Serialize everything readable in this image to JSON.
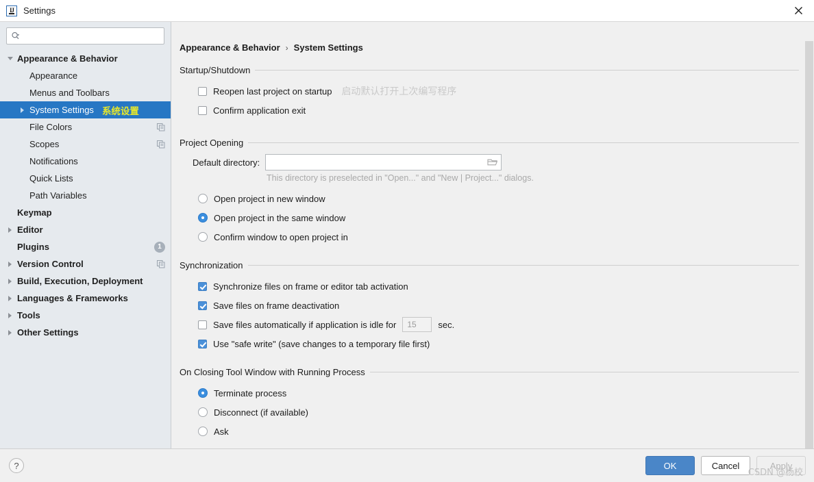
{
  "window": {
    "title": "Settings",
    "app_icon": "intellij-idea-icon",
    "close_icon": "close-icon"
  },
  "sidebar": {
    "search": {
      "value": "",
      "placeholder": "",
      "icon": "search-icon"
    },
    "items": [
      {
        "label": "Appearance & Behavior",
        "indent": 0,
        "bold": true,
        "arrow": "down",
        "selected": false,
        "right": ""
      },
      {
        "label": "Appearance",
        "indent": 1,
        "bold": false,
        "arrow": "none",
        "selected": false,
        "right": ""
      },
      {
        "label": "Menus and Toolbars",
        "indent": 1,
        "bold": false,
        "arrow": "none",
        "selected": false,
        "right": ""
      },
      {
        "label": "System Settings",
        "indent": 1,
        "bold": false,
        "arrow": "right",
        "selected": true,
        "right": "",
        "annotation": "系统设置"
      },
      {
        "label": "File Colors",
        "indent": 1,
        "bold": false,
        "arrow": "none",
        "selected": false,
        "right": "copy-icon"
      },
      {
        "label": "Scopes",
        "indent": 1,
        "bold": false,
        "arrow": "none",
        "selected": false,
        "right": "copy-icon"
      },
      {
        "label": "Notifications",
        "indent": 1,
        "bold": false,
        "arrow": "none",
        "selected": false,
        "right": ""
      },
      {
        "label": "Quick Lists",
        "indent": 1,
        "bold": false,
        "arrow": "none",
        "selected": false,
        "right": ""
      },
      {
        "label": "Path Variables",
        "indent": 1,
        "bold": false,
        "arrow": "none",
        "selected": false,
        "right": ""
      },
      {
        "label": "Keymap",
        "indent": 0,
        "bold": true,
        "arrow": "none",
        "selected": false,
        "right": ""
      },
      {
        "label": "Editor",
        "indent": 0,
        "bold": true,
        "arrow": "right",
        "selected": false,
        "right": ""
      },
      {
        "label": "Plugins",
        "indent": 0,
        "bold": true,
        "arrow": "none",
        "selected": false,
        "right": "badge",
        "badge": "1"
      },
      {
        "label": "Version Control",
        "indent": 0,
        "bold": true,
        "arrow": "right",
        "selected": false,
        "right": "copy-icon"
      },
      {
        "label": "Build, Execution, Deployment",
        "indent": 0,
        "bold": true,
        "arrow": "right",
        "selected": false,
        "right": ""
      },
      {
        "label": "Languages & Frameworks",
        "indent": 0,
        "bold": true,
        "arrow": "right",
        "selected": false,
        "right": ""
      },
      {
        "label": "Tools",
        "indent": 0,
        "bold": true,
        "arrow": "right",
        "selected": false,
        "right": ""
      },
      {
        "label": "Other Settings",
        "indent": 0,
        "bold": true,
        "arrow": "right",
        "selected": false,
        "right": ""
      }
    ]
  },
  "content": {
    "breadcrumb": {
      "parent": "Appearance & Behavior",
      "separator": "›",
      "current": "System Settings"
    },
    "sections": [
      {
        "title": "Startup/Shutdown",
        "options": [
          {
            "type": "checkbox",
            "checked": false,
            "label": "Reopen last project on startup",
            "annotation": "启动默认打开上次编写程序"
          },
          {
            "type": "checkbox",
            "checked": false,
            "label": "Confirm application exit"
          }
        ]
      },
      {
        "title": "Project Opening",
        "directory": {
          "label": "Default directory:",
          "value": "",
          "placeholder": "",
          "browse_icon": "folder-icon",
          "hint": "This directory is preselected in \"Open...\" and \"New | Project...\" dialogs."
        },
        "options": [
          {
            "type": "radio",
            "checked": false,
            "label": "Open project in new window"
          },
          {
            "type": "radio",
            "checked": true,
            "label": "Open project in the same window"
          },
          {
            "type": "radio",
            "checked": false,
            "label": "Confirm window to open project in"
          }
        ]
      },
      {
        "title": "Synchronization",
        "options": [
          {
            "type": "checkbox",
            "checked": true,
            "label": "Synchronize files on frame or editor tab activation"
          },
          {
            "type": "checkbox",
            "checked": true,
            "label": "Save files on frame deactivation"
          },
          {
            "type": "checkbox",
            "checked": false,
            "label": "Save files automatically if application is idle for",
            "number_value": "15",
            "suffix": "sec."
          },
          {
            "type": "checkbox",
            "checked": true,
            "label": "Use \"safe write\" (save changes to a temporary file first)"
          }
        ]
      },
      {
        "title": "On Closing Tool Window with Running Process",
        "options": [
          {
            "type": "radio",
            "checked": true,
            "label": "Terminate process"
          },
          {
            "type": "radio",
            "checked": false,
            "label": "Disconnect (if available)"
          },
          {
            "type": "radio",
            "checked": false,
            "label": "Ask"
          }
        ]
      }
    ]
  },
  "footer": {
    "help_label": "?",
    "ok_label": "OK",
    "cancel_label": "Cancel",
    "apply_label": "Apply",
    "apply_disabled": true,
    "watermark": "CSDN @杨校"
  },
  "colors": {
    "selection_blue": "#2777c4",
    "accent_blue": "#4a86c8",
    "checkbox_blue": "#4a90d9",
    "annotation_yellow": "#e8e82a",
    "sidebar_bg": "#e6eaee",
    "content_bg": "#f0f0f0"
  }
}
